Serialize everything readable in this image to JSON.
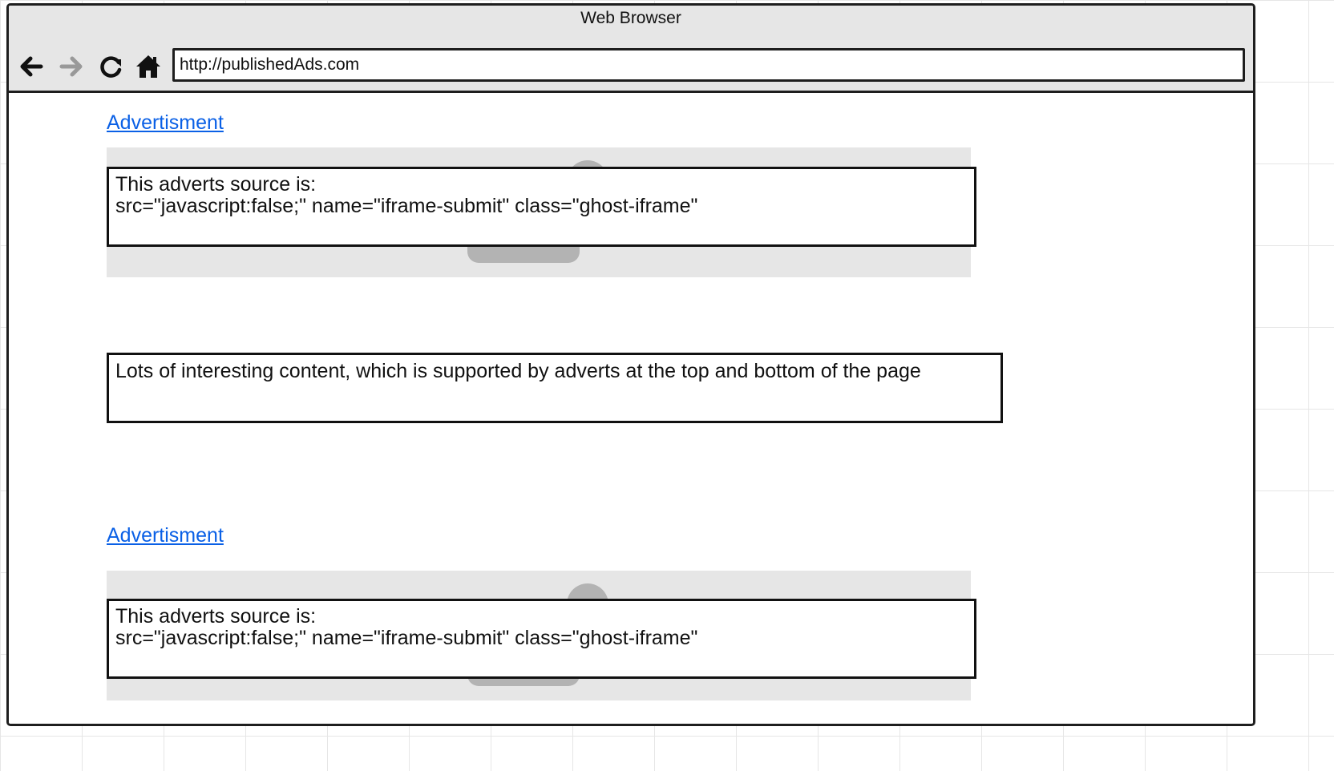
{
  "window": {
    "title": "Web Browser"
  },
  "toolbar": {
    "back_icon": "back-arrow-icon",
    "forward_icon": "forward-arrow-icon",
    "reload_icon": "reload-icon",
    "home_icon": "home-icon",
    "url": "http://publishedAds.com"
  },
  "top_ad": {
    "link_label": "Advertisment",
    "source_heading": "This adverts source is:",
    "source_value": "src=\"javascript:false;\" name=\"iframe-submit\" class=\"ghost-iframe\""
  },
  "content": {
    "text": "Lots of interesting content, which is supported by adverts at the top and bottom of the page"
  },
  "bottom_ad": {
    "link_label": "Advertisment",
    "source_heading": "This adverts source is:",
    "source_value": "src=\"javascript:false;\" name=\"iframe-submit\" class=\"ghost-iframe\""
  },
  "colors": {
    "link": "#0a60e6",
    "chrome": "#e6e6e6",
    "placeholder": "#b3b3b3"
  }
}
